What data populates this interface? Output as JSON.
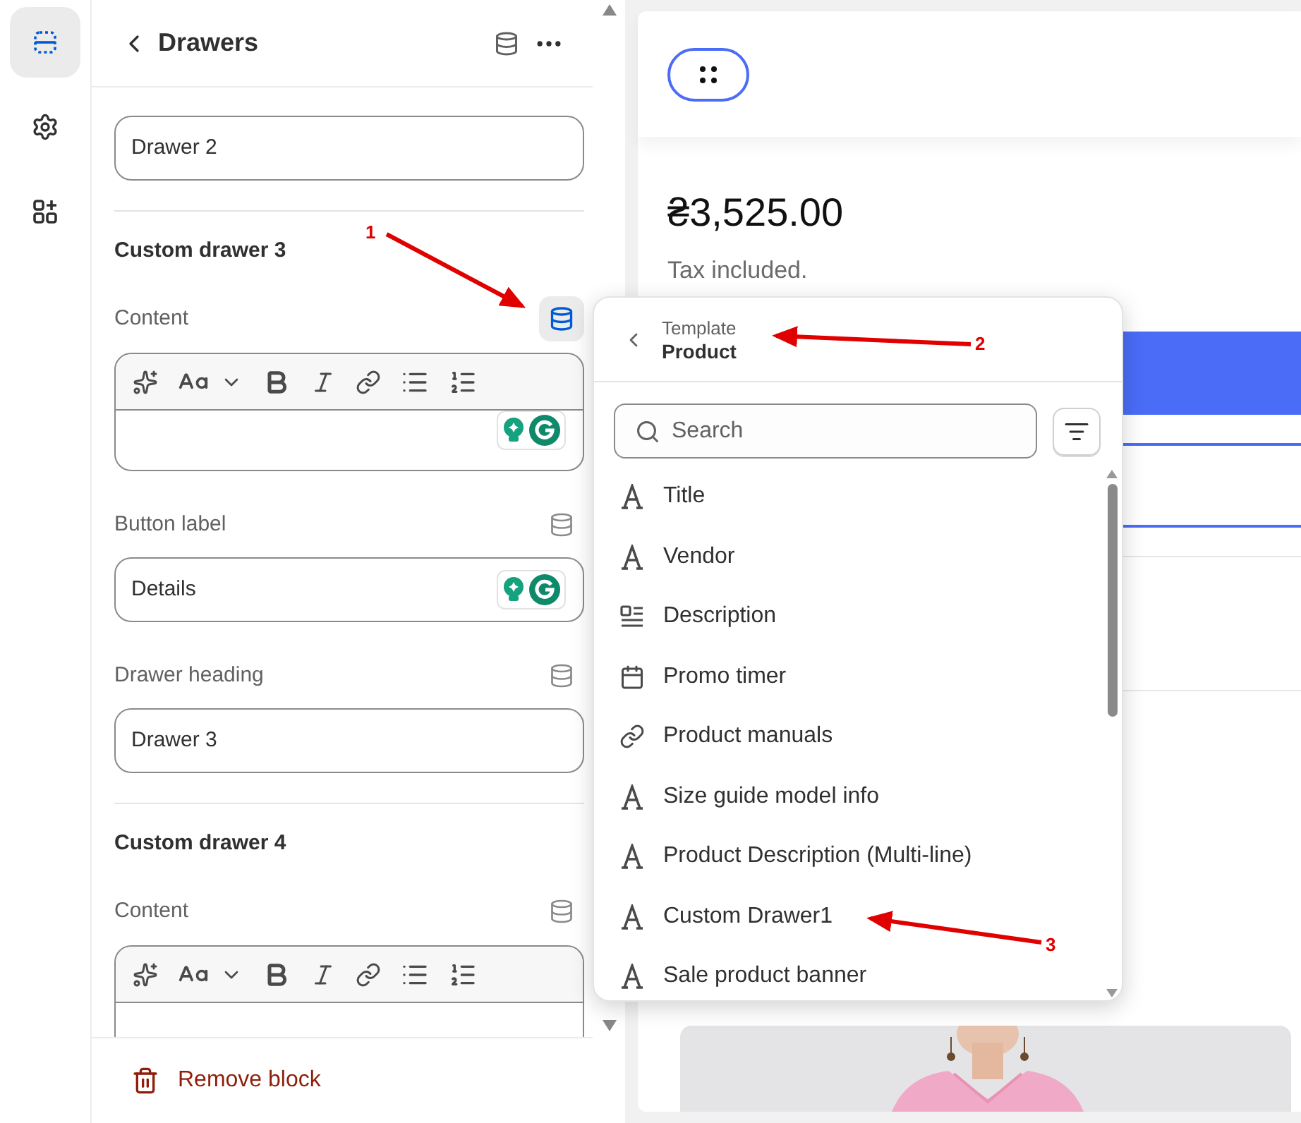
{
  "rail": [
    {
      "kind": "sections",
      "selected": true
    },
    {
      "kind": "settings",
      "selected": false
    },
    {
      "kind": "apps",
      "selected": false
    }
  ],
  "panel": {
    "title": "Drawers",
    "items": [
      {
        "kind": "input",
        "value": "Drawer 2",
        "grammarly": false
      },
      {
        "kind": "divider"
      },
      {
        "kind": "heading",
        "text": "Custom drawer 3"
      },
      {
        "kind": "label",
        "text": "Content",
        "source_active": true
      },
      {
        "kind": "rich_text",
        "grammarly": true
      },
      {
        "kind": "label",
        "text": "Button label",
        "source_active": false
      },
      {
        "kind": "input",
        "value": "Details",
        "grammarly": true
      },
      {
        "kind": "label",
        "text": "Drawer heading",
        "source_active": false
      },
      {
        "kind": "input",
        "value": "Drawer 3",
        "grammarly": false
      },
      {
        "kind": "divider"
      },
      {
        "kind": "heading",
        "text": "Custom drawer 4"
      },
      {
        "kind": "label",
        "text": "Content",
        "source_active": false
      },
      {
        "kind": "rich_text",
        "grammarly": false
      }
    ],
    "footer": {
      "label": "Remove block"
    }
  },
  "preview": {
    "price": "₴3,525.00",
    "tax_note": "Tax included."
  },
  "popover": {
    "breadcrumb": "Template",
    "title": "Product",
    "search": {
      "placeholder": "Search"
    },
    "items": [
      {
        "kind": "text",
        "label": "Title"
      },
      {
        "kind": "text",
        "label": "Vendor"
      },
      {
        "kind": "description",
        "label": "Description"
      },
      {
        "kind": "calendar",
        "label": "Promo timer"
      },
      {
        "kind": "link",
        "label": "Product manuals"
      },
      {
        "kind": "text",
        "label": "Size guide model info"
      },
      {
        "kind": "text",
        "label": "Product Description (Multi-line)"
      },
      {
        "kind": "text",
        "label": "Custom Drawer1"
      },
      {
        "kind": "text",
        "label": "Sale product banner"
      }
    ]
  },
  "annotations": [
    {
      "number": "1"
    },
    {
      "number": "2"
    },
    {
      "number": "3"
    }
  ]
}
